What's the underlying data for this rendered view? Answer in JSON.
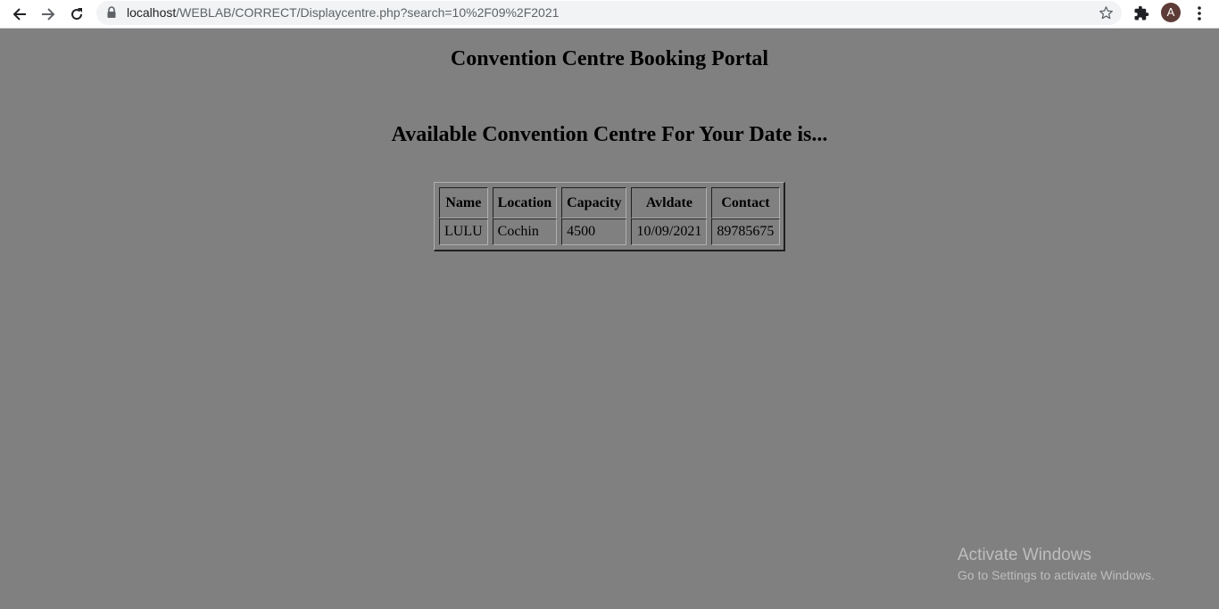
{
  "browser": {
    "url_host": "localhost",
    "url_path": "/WEBLAB/CORRECT/Displaycentre.php?search=10%2F09%2F2021",
    "profile_initial": "A",
    "icons": {
      "back": "arrow-left-icon",
      "forward": "arrow-right-icon",
      "reload": "reload-icon",
      "lock": "lock-icon",
      "bookmark": "star-icon",
      "extensions": "puzzle-icon",
      "menu": "kebab-menu-icon"
    }
  },
  "page": {
    "title": "Convention Centre Booking Portal",
    "subtitle": "Available Convention Centre For Your Date is...",
    "background_color": "#808080"
  },
  "table": {
    "headers": [
      "Name",
      "Location",
      "Capacity",
      "Avldate",
      "Contact"
    ],
    "rows": [
      [
        "LULU",
        "Cochin",
        "4500",
        "10/09/2021",
        "89785675"
      ]
    ]
  },
  "watermark": {
    "title": "Activate Windows",
    "subtitle": "Go to Settings to activate Windows."
  }
}
